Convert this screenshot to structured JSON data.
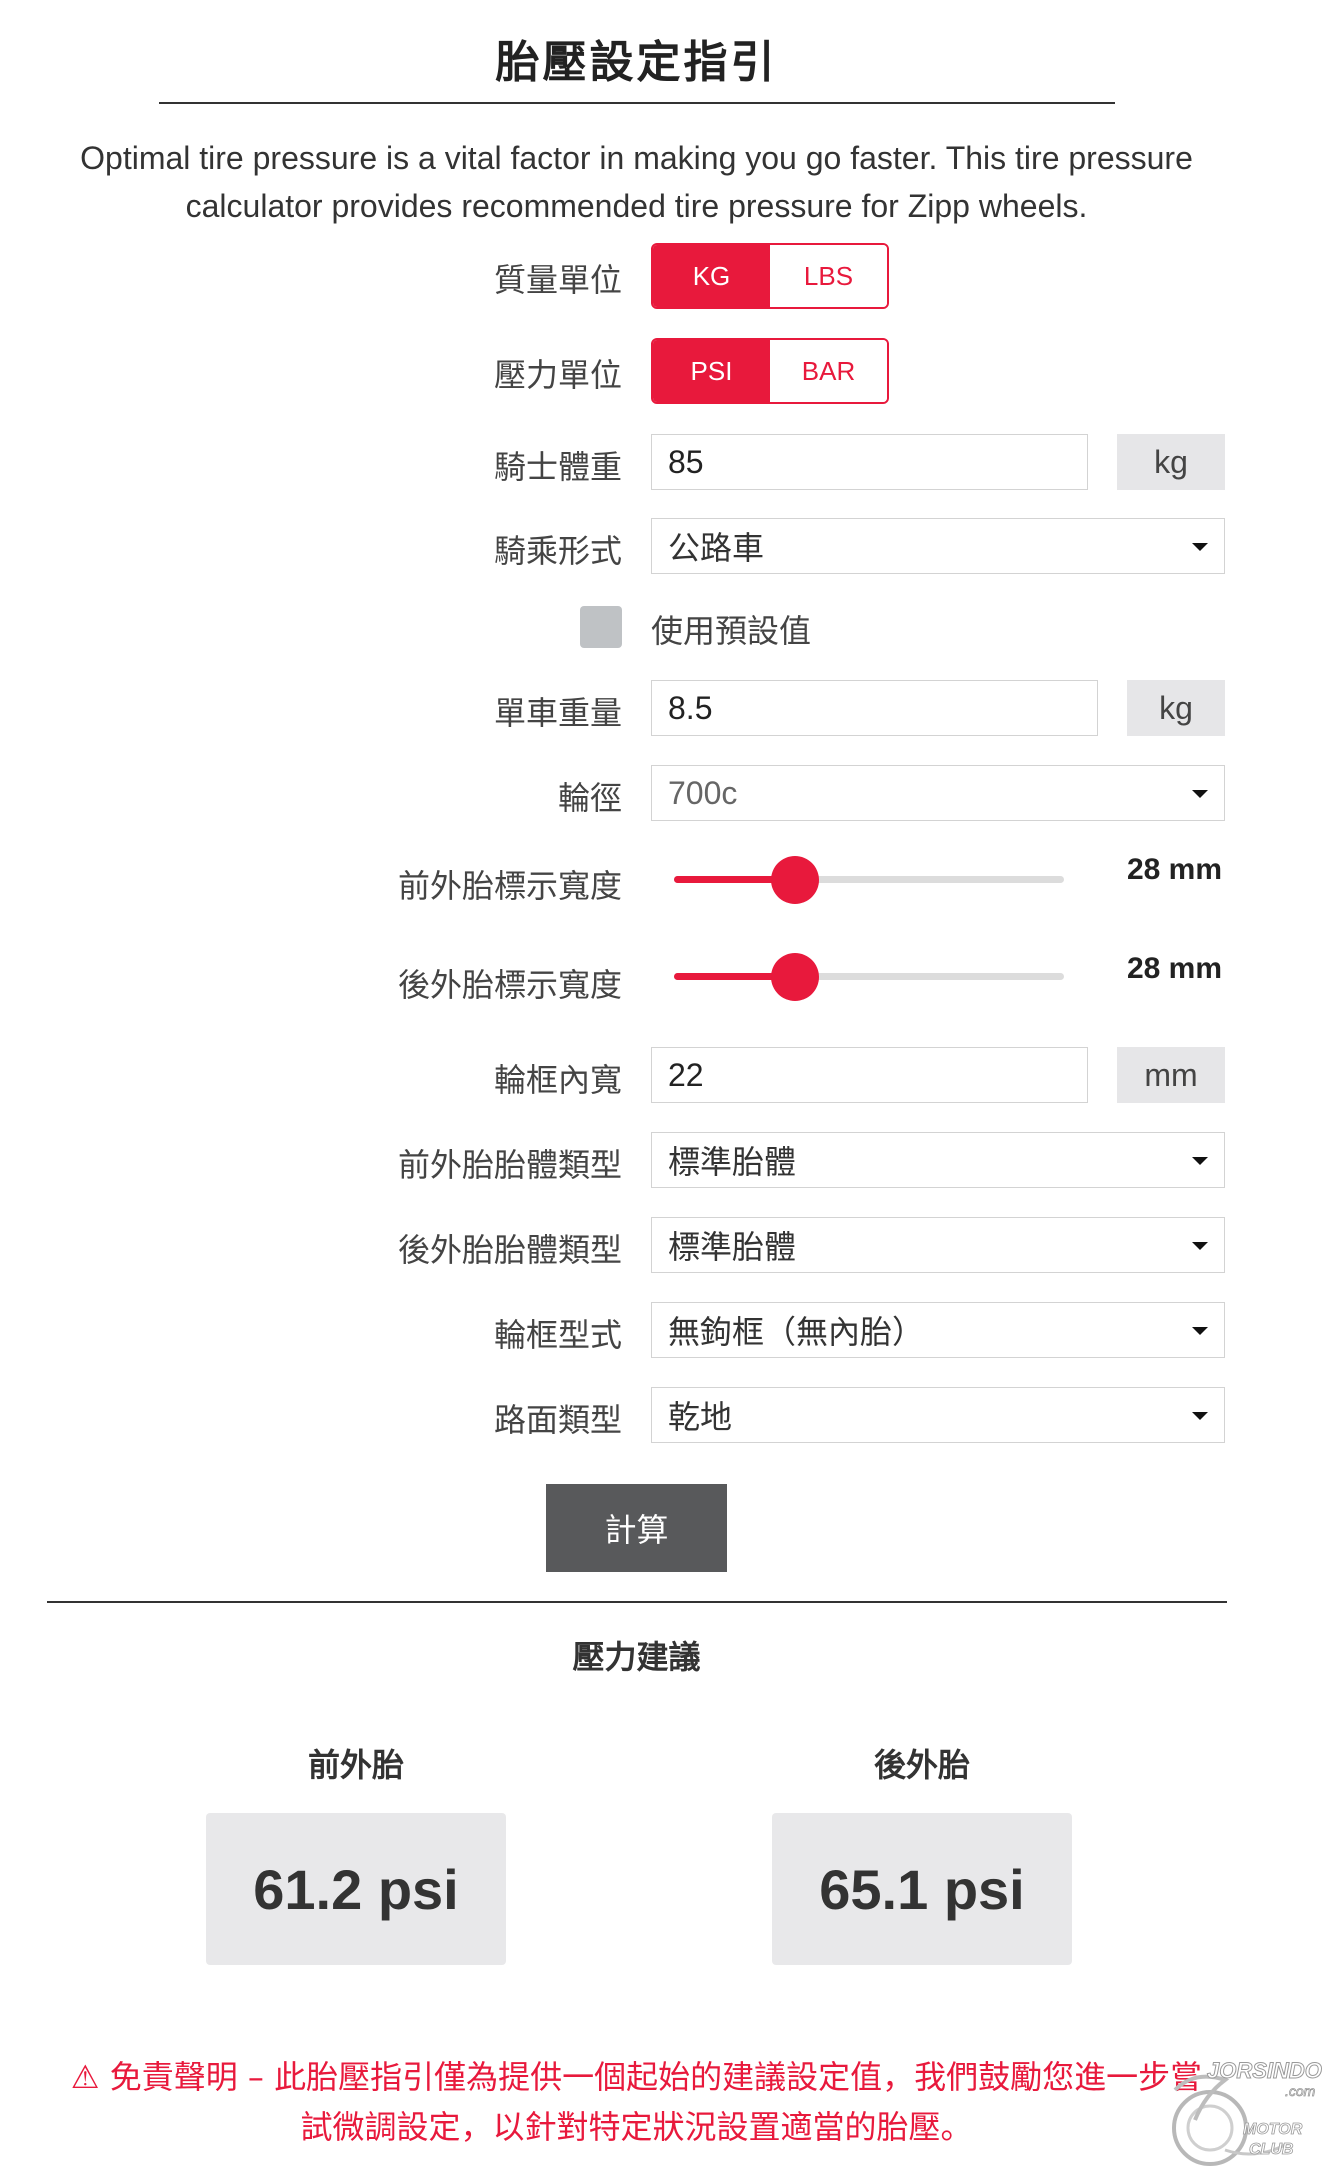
{
  "header": {
    "title": "胎壓設定指引",
    "intro": "Optimal tire pressure is a vital factor in making you go faster. This tire pressure calculator provides recommended tire pressure for Zipp wheels."
  },
  "form": {
    "mass_unit": {
      "label": "質量單位",
      "options": [
        "KG",
        "LBS"
      ],
      "selected": "KG"
    },
    "pressure_unit": {
      "label": "壓力單位",
      "options": [
        "PSI",
        "BAR"
      ],
      "selected": "PSI"
    },
    "rider_weight": {
      "label": "騎士體重",
      "value": "85",
      "unit": "kg"
    },
    "riding_style": {
      "label": "騎乘形式",
      "value": "公路車"
    },
    "use_default": {
      "label": "使用預設值",
      "checked": false
    },
    "bike_weight": {
      "label": "單車重量",
      "value": "8.5",
      "unit": "kg"
    },
    "wheel_diameter": {
      "label": "輪徑",
      "value": "700c"
    },
    "front_tire_width": {
      "label": "前外胎標示寬度",
      "display": "28 mm",
      "fraction": 0.31
    },
    "rear_tire_width": {
      "label": "後外胎標示寬度",
      "display": "28 mm",
      "fraction": 0.31
    },
    "rim_inner_width": {
      "label": "輪框內寬",
      "value": "22",
      "unit": "mm"
    },
    "front_casing": {
      "label": "前外胎胎體類型",
      "value": "標準胎體"
    },
    "rear_casing": {
      "label": "後外胎胎體類型",
      "value": "標準胎體"
    },
    "rim_type": {
      "label": "輪框型式",
      "value": "無鉤框（無內胎）"
    },
    "surface": {
      "label": "路面類型",
      "value": "乾地"
    },
    "calculate_label": "計算"
  },
  "results": {
    "title": "壓力建議",
    "front_label": "前外胎",
    "front_value": "61.2 psi",
    "rear_label": "後外胎",
    "rear_value": "65.1 psi"
  },
  "disclaimer": "⚠ 免責聲明 – 此胎壓指引僅為提供一個起始的建議設定值，我們鼓勵您進一步嘗試微調設定，以針對特定狀況設置適當的胎壓。",
  "watermark": {
    "line1": "JORSINDO",
    "line2": ".com",
    "line3": "MOTOR",
    "line4": "CLUB"
  },
  "colors": {
    "accent": "#e8193c",
    "button": "#58595b",
    "unit_bg": "#e6e6e8",
    "result_bg": "#e8e8ea"
  }
}
